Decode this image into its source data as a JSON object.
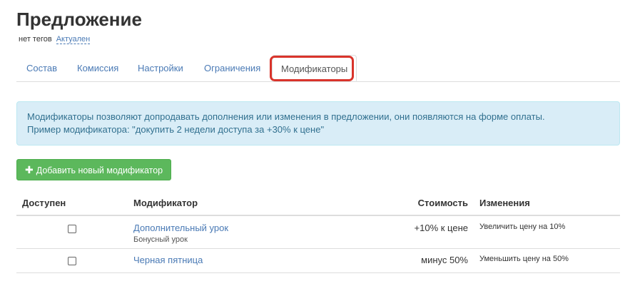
{
  "header": {
    "title": "Предложение",
    "tags": "нет тегов",
    "status": "Актуален"
  },
  "tabs": [
    {
      "label": "Состав",
      "active": false
    },
    {
      "label": "Комиссия",
      "active": false
    },
    {
      "label": "Настройки",
      "active": false
    },
    {
      "label": "Ограничения",
      "active": false
    },
    {
      "label": "Модификаторы",
      "active": true
    }
  ],
  "info": {
    "line1": "Модификаторы позволяют допродавать дополнения или изменения в предложении, они появляются на форме оплаты.",
    "line2": "Пример модификатора: \"докупить 2 недели доступа за +30% к цене\""
  },
  "add_button": {
    "label": "Добавить новый модификатор",
    "icon": "plus-icon"
  },
  "table": {
    "headers": {
      "available": "Доступен",
      "modifier": "Модификатор",
      "cost": "Стоимость",
      "changes": "Изменения"
    },
    "rows": [
      {
        "name": "Дополнительный урок",
        "subtitle": "Бонусный урок",
        "cost": "+10% к цене",
        "change": "Увеличить цену на 10%",
        "available": false
      },
      {
        "name": "Черная пятница",
        "subtitle": "",
        "cost": "минус 50%",
        "change": "Уменьшить цену на 50%",
        "available": false
      }
    ]
  },
  "colors": {
    "link": "#4a7ab5",
    "info_bg": "#d9edf7",
    "info_text": "#31708f",
    "success": "#5cb85c",
    "highlight": "#d9342b"
  }
}
